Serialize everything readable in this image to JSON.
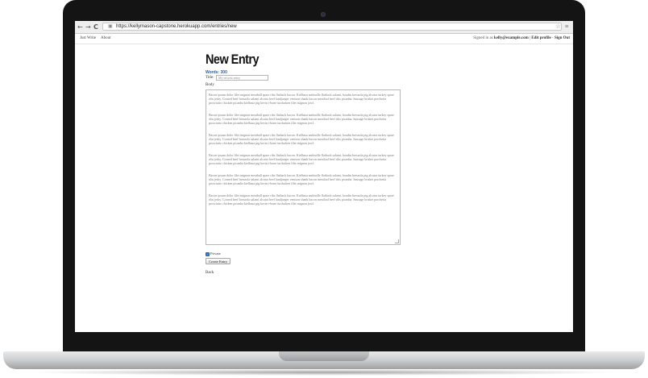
{
  "browser": {
    "url": "https://kellymason-capstone.herokuapp.com/entries/new",
    "back_icon": "←",
    "forward_icon": "→",
    "reload_icon": "C",
    "star_icon": "☆",
    "menu_icon": "≡"
  },
  "site_nav": {
    "links": [
      "Just Write",
      "About"
    ],
    "signed_in_prefix": "Signed in as",
    "user": "kelly@example.com",
    "edit_profile": "Edit profile",
    "separator": "-",
    "sign_out": "Sign Out"
  },
  "form": {
    "heading": "New Entry",
    "word_count": "Words: 300",
    "title_label": "Title:",
    "title_placeholder": "My newest entry",
    "body_label": "Body",
    "paragraphs": [
      "Bacon ipsum dolor filet mignon meatball spare ribs flatback bacon. Kielbasa andouille flatback salami, boudin bresaola pig alcatra turkey spare ribs jerky. Corned beef bresaola salami alcatra beef landjaeger venison shank bacon meatloaf beef ribs picanha. Sausage brisket porchetta prosciutto chicken picanha kielbasa pig kevin t-bone turducken filet mignon jowl.",
      "Bacon ipsum dolor filet mignon meatball spare ribs flatback bacon. Kielbasa andouille flatback salami, boudin bresaola pig alcatra turkey spare ribs jerky. Corned beef bresaola salami alcatra beef landjaeger venison shank bacon meatloaf beef ribs picanha. Sausage brisket porchetta prosciutto chicken picanha kielbasa pig kevin t-bone turducken filet mignon jowl.",
      "Bacon ipsum dolor filet mignon meatball spare ribs flatback bacon. Kielbasa andouille flatback salami, boudin bresaola pig alcatra turkey spare ribs jerky. Corned beef bresaola salami alcatra beef landjaeger venison shank bacon meatloaf beef ribs picanha. Sausage brisket porchetta prosciutto chicken picanha kielbasa pig kevin t-bone turducken filet mignon jowl.",
      "Bacon ipsum dolor filet mignon meatball spare ribs flatback bacon. Kielbasa andouille flatback salami, boudin bresaola pig alcatra turkey spare ribs jerky. Corned beef bresaola salami alcatra beef landjaeger venison shank bacon meatloaf beef ribs picanha. Sausage brisket porchetta prosciutto chicken picanha kielbasa pig kevin t-bone turducken filet mignon jowl.",
      "Bacon ipsum dolor filet mignon meatball spare ribs flatback bacon. Kielbasa andouille flatback salami, boudin bresaola pig alcatra turkey spare ribs jerky. Corned beef bresaola salami alcatra beef landjaeger venison shank bacon meatloaf beef ribs picanha. Sausage brisket porchetta prosciutto chicken picanha kielbasa pig kevin t-bone turducken filet mignon jowl.",
      "Bacon ipsum dolor filet mignon meatball spare ribs flatback bacon. Kielbasa andouille flatback salami, boudin bresaola pig alcatra turkey spare ribs jerky. Corned beef bresaola salami alcatra beef landjaeger venison shank bacon meatloaf beef ribs picanha. Sausage brisket porchetta prosciutto chicken picanha kielbasa pig kevin t-bone turducken filet mignon jowl."
    ],
    "private_label": "Private",
    "private_checked": true,
    "submit_label": "Create Entry",
    "back_label": "Back"
  },
  "colors": {
    "word_count": "#2c5f9e",
    "checkbox": "#3b82d9",
    "laptop_bezel": "#141414"
  }
}
